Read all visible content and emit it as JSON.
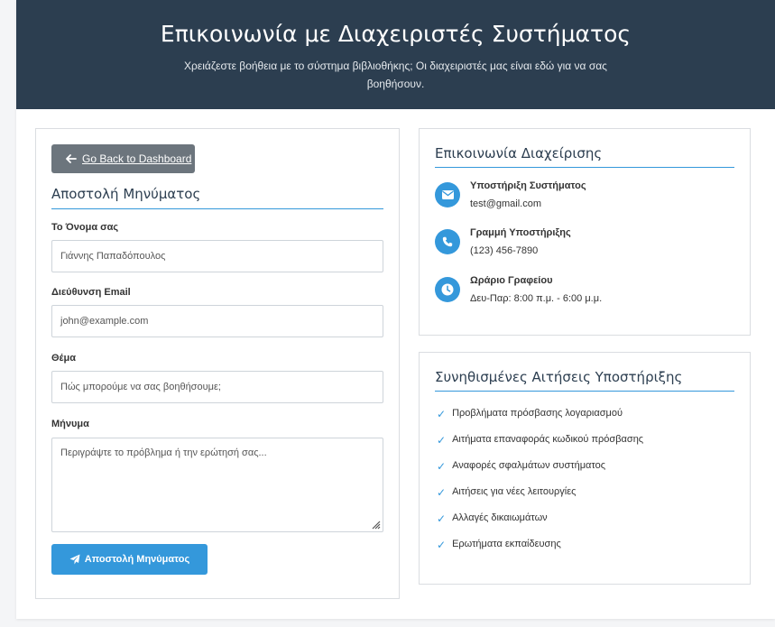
{
  "header": {
    "title": "Επικοινωνία με Διαχειριστές Συστήματος",
    "subtitle": "Χρειάζεστε βοήθεια με το σύστημα βιβλιοθήκης; Οι διαχειριστές μας είναι εδώ για να σας βοηθήσουν."
  },
  "form": {
    "back_label": "Go Back to Dashboard",
    "title": "Αποστολή Μηνύματος",
    "name_label": "Το Όνομα σας",
    "name_placeholder": "Γιάννης Παπαδόπουλος",
    "email_label": "Διεύθυνση Email",
    "email_placeholder": "john@example.com",
    "subject_label": "Θέμα",
    "subject_placeholder": "Πώς μπορούμε να σας βοηθήσουμε;",
    "message_label": "Μήνυμα",
    "message_placeholder": "Περιγράψτε το πρόβλημα ή την ερώτησή σας...",
    "submit_label": "Αποστολή Μηνύματος"
  },
  "contact": {
    "title": "Επικοινωνία Διαχείρισης",
    "items": [
      {
        "icon": "envelope-icon",
        "title": "Υποστήριξη Συστήματος",
        "value": "test@gmail.com"
      },
      {
        "icon": "phone-icon",
        "title": "Γραμμή Υποστήριξης",
        "value": "(123) 456-7890"
      },
      {
        "icon": "clock-icon",
        "title": "Ωράριο Γραφείου",
        "value": "Δευ-Παρ: 8:00 π.μ. - 6:00 μ.μ."
      }
    ]
  },
  "requests": {
    "title": "Συνηθισμένες Αιτήσεις Υποστήριξης",
    "items": [
      "Προβλήματα πρόσβασης λογαριασμού",
      "Αιτήματα επαναφοράς κωδικού πρόσβασης",
      "Αναφορές σφαλμάτων συστήματος",
      "Αιτήσεις για νέες λειτουργίες",
      "Αλλαγές δικαιωμάτων",
      "Ερωτήματα εκπαίδευσης"
    ]
  },
  "colors": {
    "header_bg": "#2c3e50",
    "accent": "#3498db",
    "back_button": "#6c757d"
  }
}
